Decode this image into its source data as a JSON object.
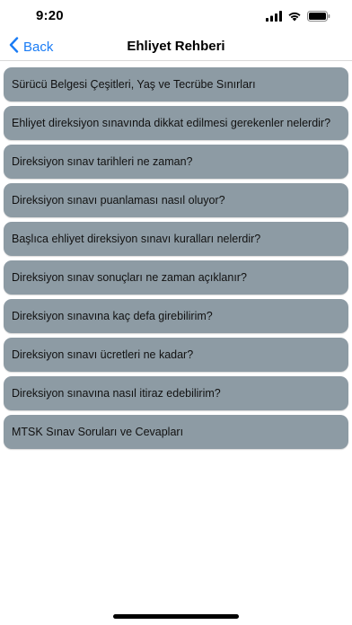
{
  "status_bar": {
    "time": "9:20"
  },
  "nav": {
    "back_label": "Back",
    "title": "Ehliyet Rehberi"
  },
  "topics": [
    {
      "label": "Sürücü Belgesi Çeşitleri, Yaş ve Tecrübe Sınırları"
    },
    {
      "label": "Ehliyet direksiyon sınavında dikkat edilmesi gerekenler nelerdir?"
    },
    {
      "label": "Direksiyon sınav tarihleri ne zaman?"
    },
    {
      "label": "Direksiyon sınavı puanlaması nasıl oluyor?"
    },
    {
      "label": "Başlıca ehliyet direksiyon sınavı kuralları nelerdir?"
    },
    {
      "label": "Direksiyon sınav sonuçları ne zaman açıklanır?"
    },
    {
      "label": "Direksiyon sınavına kaç defa girebilirim?"
    },
    {
      "label": "Direksiyon sınavı ücretleri ne kadar?"
    },
    {
      "label": "Direksiyon sınavına nasıl itiraz edebilirim?"
    },
    {
      "label": "MTSK Sınav Soruları ve Cevapları"
    }
  ],
  "colors": {
    "accent": "#1a7cf5",
    "list_item_bg": "#8d9ba4"
  },
  "icons": {
    "signal": "cellular-signal-icon",
    "wifi": "wifi-icon",
    "battery": "battery-icon",
    "back": "chevron-left-icon"
  }
}
